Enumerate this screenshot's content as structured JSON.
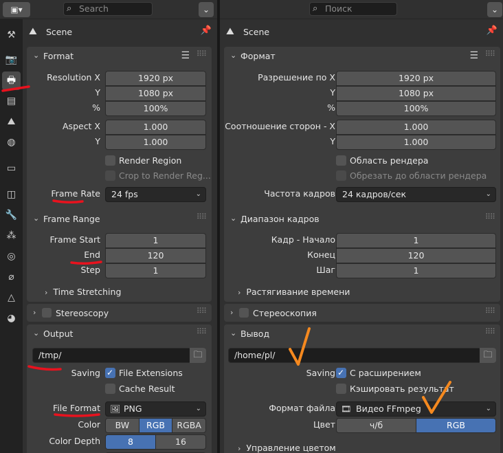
{
  "left": {
    "search_placeholder": "Search",
    "context_title": "Scene",
    "format": {
      "title": "Format",
      "res_x_label": "Resolution X",
      "res_x": "1920 px",
      "res_y_label": "Y",
      "res_y": "1080 px",
      "res_pct_label": "%",
      "res_pct": "100%",
      "aspect_x_label": "Aspect X",
      "aspect_x": "1.000",
      "aspect_y_label": "Y",
      "aspect_y": "1.000",
      "render_region": "Render Region",
      "crop": "Crop to Render Reg...",
      "frame_rate_label": "Frame Rate",
      "frame_rate": "24 fps"
    },
    "frame_range": {
      "title": "Frame Range",
      "start_label": "Frame Start",
      "start": "1",
      "end_label": "End",
      "end": "120",
      "step_label": "Step",
      "step": "1",
      "stretching": "Time Stretching"
    },
    "stereoscopy": "Stereoscopy",
    "output": {
      "title": "Output",
      "path": "/tmp/",
      "saving_label": "Saving",
      "file_ext": "File Extensions",
      "cache_result": "Cache Result",
      "file_format_label": "File Format",
      "file_format": "PNG",
      "color_label": "Color",
      "color_opts": [
        "BW",
        "RGB",
        "RGBA"
      ],
      "depth_label": "Color Depth",
      "depth_opts": [
        "8",
        "16"
      ]
    }
  },
  "right": {
    "search_placeholder": "Поиск",
    "context_title": "Scene",
    "format": {
      "title": "Формат",
      "res_x_label": "Разрешение по X",
      "res_x": "1920 px",
      "res_y_label": "Y",
      "res_y": "1080 px",
      "res_pct_label": "%",
      "res_pct": "100%",
      "aspect_x_label": "Соотношение сторон - X",
      "aspect_x": "1.000",
      "aspect_y_label": "Y",
      "aspect_y": "1.000",
      "render_region": "Область рендера",
      "crop": "Обрезать до области рендера",
      "frame_rate_label": "Частота кадров",
      "frame_rate": "24 кадров/сек"
    },
    "frame_range": {
      "title": "Диапазон кадров",
      "start_label": "Кадр - Начало",
      "start": "1",
      "end_label": "Конец",
      "end": "120",
      "step_label": "Шаг",
      "step": "1",
      "stretching": "Растягивание времени"
    },
    "stereoscopy": "Стереоскопия",
    "output": {
      "title": "Вывод",
      "path": "/home/pl/",
      "saving_label": "Saving",
      "file_ext": "С расширением",
      "cache_result": "Кэшировать результат",
      "file_format_label": "Формат файла",
      "file_format": "Видео FFmpeg",
      "color_label": "Цвет",
      "color_opts": [
        "ч/б",
        "RGB"
      ],
      "color_mgmt": "Управление цветом"
    }
  },
  "colors": {
    "accent": "#4772b3",
    "red_marks": "#e8121e",
    "orange_marks": "#f5891f"
  },
  "icons": [
    "editor-type-icon",
    "search-icon",
    "filter-icon",
    "scene-icon",
    "pin-icon",
    "list-icon",
    "drag-handle-icon",
    "folder-icon",
    "chevron-down-icon",
    "chevron-right-icon"
  ]
}
